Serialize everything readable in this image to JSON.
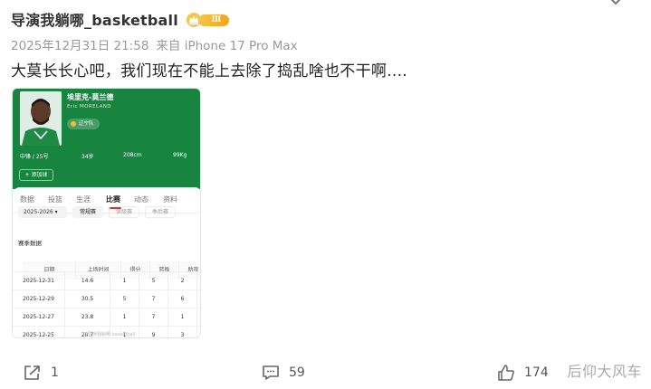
{
  "post": {
    "username": "导演我躺哪_basketball",
    "vip_level": "Ⅲ",
    "timestamp": "2025年12月31日 21:58",
    "source": "来自 iPhone 17 Pro Max",
    "content": "大莫长长心吧，我们现在不能上去除了捣乱啥也不干啊...."
  },
  "card": {
    "player_name": "埃里克-莫兰德",
    "player_name_en": "Eric MORELAND",
    "team": "辽宁队",
    "position_number": "中锋 / 25号",
    "age": "34岁",
    "height": "208cm",
    "weight": "99Kg",
    "follow_label": "+ 添加球",
    "tabs": [
      {
        "label": "数据",
        "active": false
      },
      {
        "label": "投篮",
        "active": false
      },
      {
        "label": "生涯",
        "active": false
      },
      {
        "label": "比赛",
        "active": true
      },
      {
        "label": "动态",
        "active": false
      },
      {
        "label": "资料",
        "active": false
      }
    ],
    "season": "2025-2026",
    "segments": [
      "常规赛",
      "保级赛",
      "季后赛"
    ],
    "section_title": "赛季数据",
    "table": {
      "headers": [
        "日期",
        "上场时间",
        "得分",
        "篮板",
        "助攻",
        ""
      ],
      "rows": [
        [
          "2025-12-31",
          "14.6",
          "1",
          "5",
          "2"
        ],
        [
          "2025-12-29",
          "30.5",
          "5",
          "7",
          "6"
        ],
        [
          "2025-12-27",
          "23.8",
          "1",
          "7",
          "1"
        ],
        [
          "2025-12-25",
          "20.7",
          "1",
          "9",
          "3"
        ]
      ]
    },
    "watermark": "@导演我躺哪 basketball"
  },
  "actions": {
    "share_count": "1",
    "comment_count": "59",
    "like_count": "174"
  },
  "page_watermark": "后仰大风车",
  "colors": {
    "card_green": "#17843f",
    "vip_gold": "#f2a51c",
    "active_tab_underline": "#dd3333"
  }
}
